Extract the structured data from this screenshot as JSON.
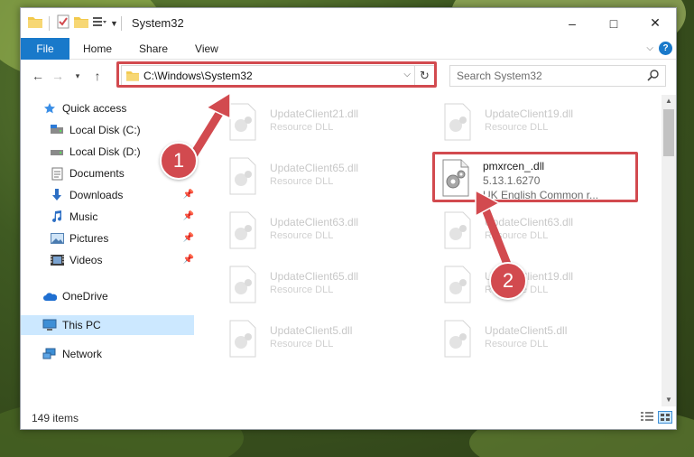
{
  "window": {
    "title": "System32",
    "controls": {
      "minimize": "–",
      "maximize": "□",
      "close": "✕"
    }
  },
  "ribbon": {
    "tabs": [
      {
        "label": "File",
        "active": true
      },
      {
        "label": "Home"
      },
      {
        "label": "Share"
      },
      {
        "label": "View"
      }
    ],
    "help_label": "?"
  },
  "nav": {
    "address": "C:\\Windows\\System32",
    "search_placeholder": "Search System32"
  },
  "sidebar": {
    "items": [
      {
        "label": "Quick access",
        "icon": "star-icon",
        "pinned": false
      },
      {
        "label": "Local Disk (C:)",
        "icon": "drive-icon",
        "pinned": false
      },
      {
        "label": "Local Disk (D:)",
        "icon": "drive-icon",
        "pinned": false
      },
      {
        "label": "Documents",
        "icon": "documents-icon",
        "pinned": false
      },
      {
        "label": "Downloads",
        "icon": "download-icon",
        "pinned": true
      },
      {
        "label": "Music",
        "icon": "music-icon",
        "pinned": true
      },
      {
        "label": "Pictures",
        "icon": "pictures-icon",
        "pinned": true
      },
      {
        "label": "Videos",
        "icon": "videos-icon",
        "pinned": true
      },
      {
        "label": "OneDrive",
        "icon": "cloud-icon",
        "pinned": false
      },
      {
        "label": "This PC",
        "icon": "computer-icon",
        "selected": true
      },
      {
        "label": "Network",
        "icon": "network-icon",
        "pinned": false
      }
    ]
  },
  "files": [
    {
      "name": "UpdateClient21.dll",
      "desc": "Resource DLL"
    },
    {
      "name": "UpdateClient19.dll",
      "desc": "Resource DLL"
    },
    {
      "name": "UpdateClient65.dll",
      "desc": "Resource DLL"
    },
    {
      "name": "pmxrcen_.dll",
      "desc": "5.13.1.6270",
      "desc2": "UK English Common r...",
      "active": true
    },
    {
      "name": "UpdateClient63.dll",
      "desc": "Resource DLL"
    },
    {
      "name": "UpdateClient63.dll",
      "desc": "Resource DLL"
    },
    {
      "name": "UpdateClient65.dll",
      "desc": "Resource DLL"
    },
    {
      "name": "UpdateClient19.dll",
      "desc": "Resource DLL"
    },
    {
      "name": "UpdateClient5.dll",
      "desc": "Resource DLL"
    },
    {
      "name": "UpdateClient5.dll",
      "desc": "Resource DLL"
    }
  ],
  "status": {
    "item_count": "149 items"
  },
  "callouts": {
    "one": "1",
    "two": "2"
  },
  "colors": {
    "accent": "#1979ca",
    "highlight": "#d24a4f",
    "selection": "#cce8ff"
  }
}
